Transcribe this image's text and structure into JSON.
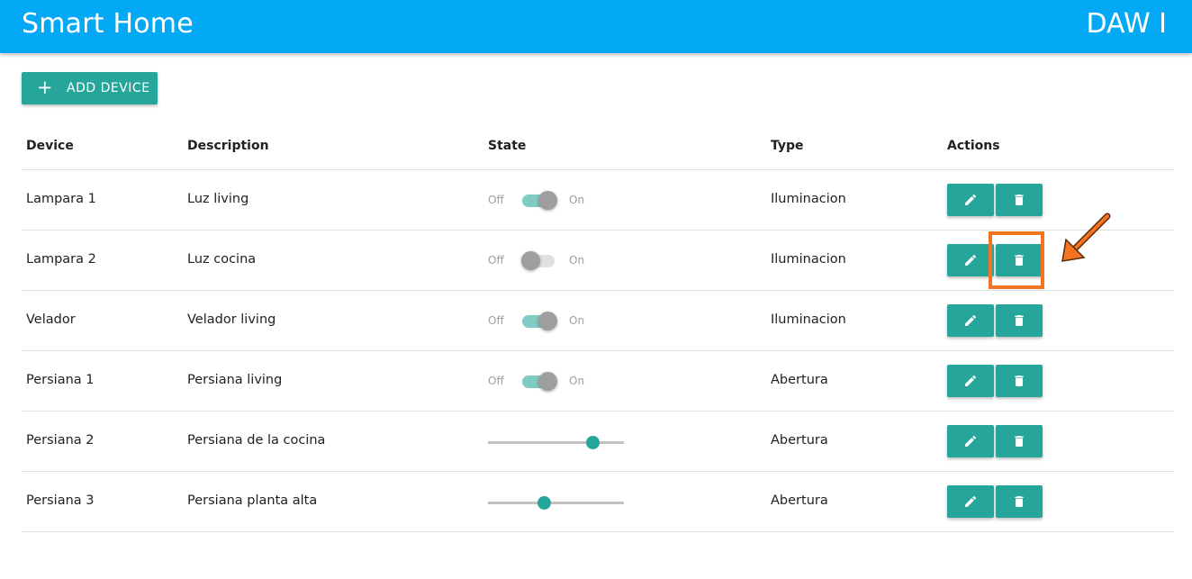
{
  "header": {
    "title": "Smart Home",
    "right_label": "DAW I"
  },
  "toolbar": {
    "add_device_label": "ADD DEVICE",
    "add_icon": "plus-icon"
  },
  "table": {
    "columns": [
      "Device",
      "Description",
      "State",
      "Type",
      "Actions"
    ],
    "state_labels": {
      "off": "Off",
      "on": "On"
    },
    "rows": [
      {
        "device": "Lampara 1",
        "description": "Luz living",
        "state_kind": "switch",
        "state_on": true,
        "type": "Iluminacion"
      },
      {
        "device": "Lampara 2",
        "description": "Luz cocina",
        "state_kind": "switch",
        "state_on": false,
        "type": "Iluminacion"
      },
      {
        "device": "Velador",
        "description": "Velador living",
        "state_kind": "switch",
        "state_on": true,
        "type": "Iluminacion"
      },
      {
        "device": "Persiana 1",
        "description": "Persiana living",
        "state_kind": "switch",
        "state_on": true,
        "type": "Abertura"
      },
      {
        "device": "Persiana 2",
        "description": "Persiana de la cocina",
        "state_kind": "slider",
        "slider_value_pct": 77,
        "type": "Abertura"
      },
      {
        "device": "Persiana 3",
        "description": "Persiana planta alta",
        "state_kind": "slider",
        "slider_value_pct": 41,
        "type": "Abertura"
      }
    ],
    "action_icons": {
      "edit": "pencil-icon",
      "delete": "trash-icon"
    }
  },
  "annotation": {
    "highlighted_row": 1,
    "highlighted_action": "delete",
    "color": "#f47421"
  },
  "colors": {
    "appbar": "#03a9f4",
    "accent": "#26a69a"
  }
}
